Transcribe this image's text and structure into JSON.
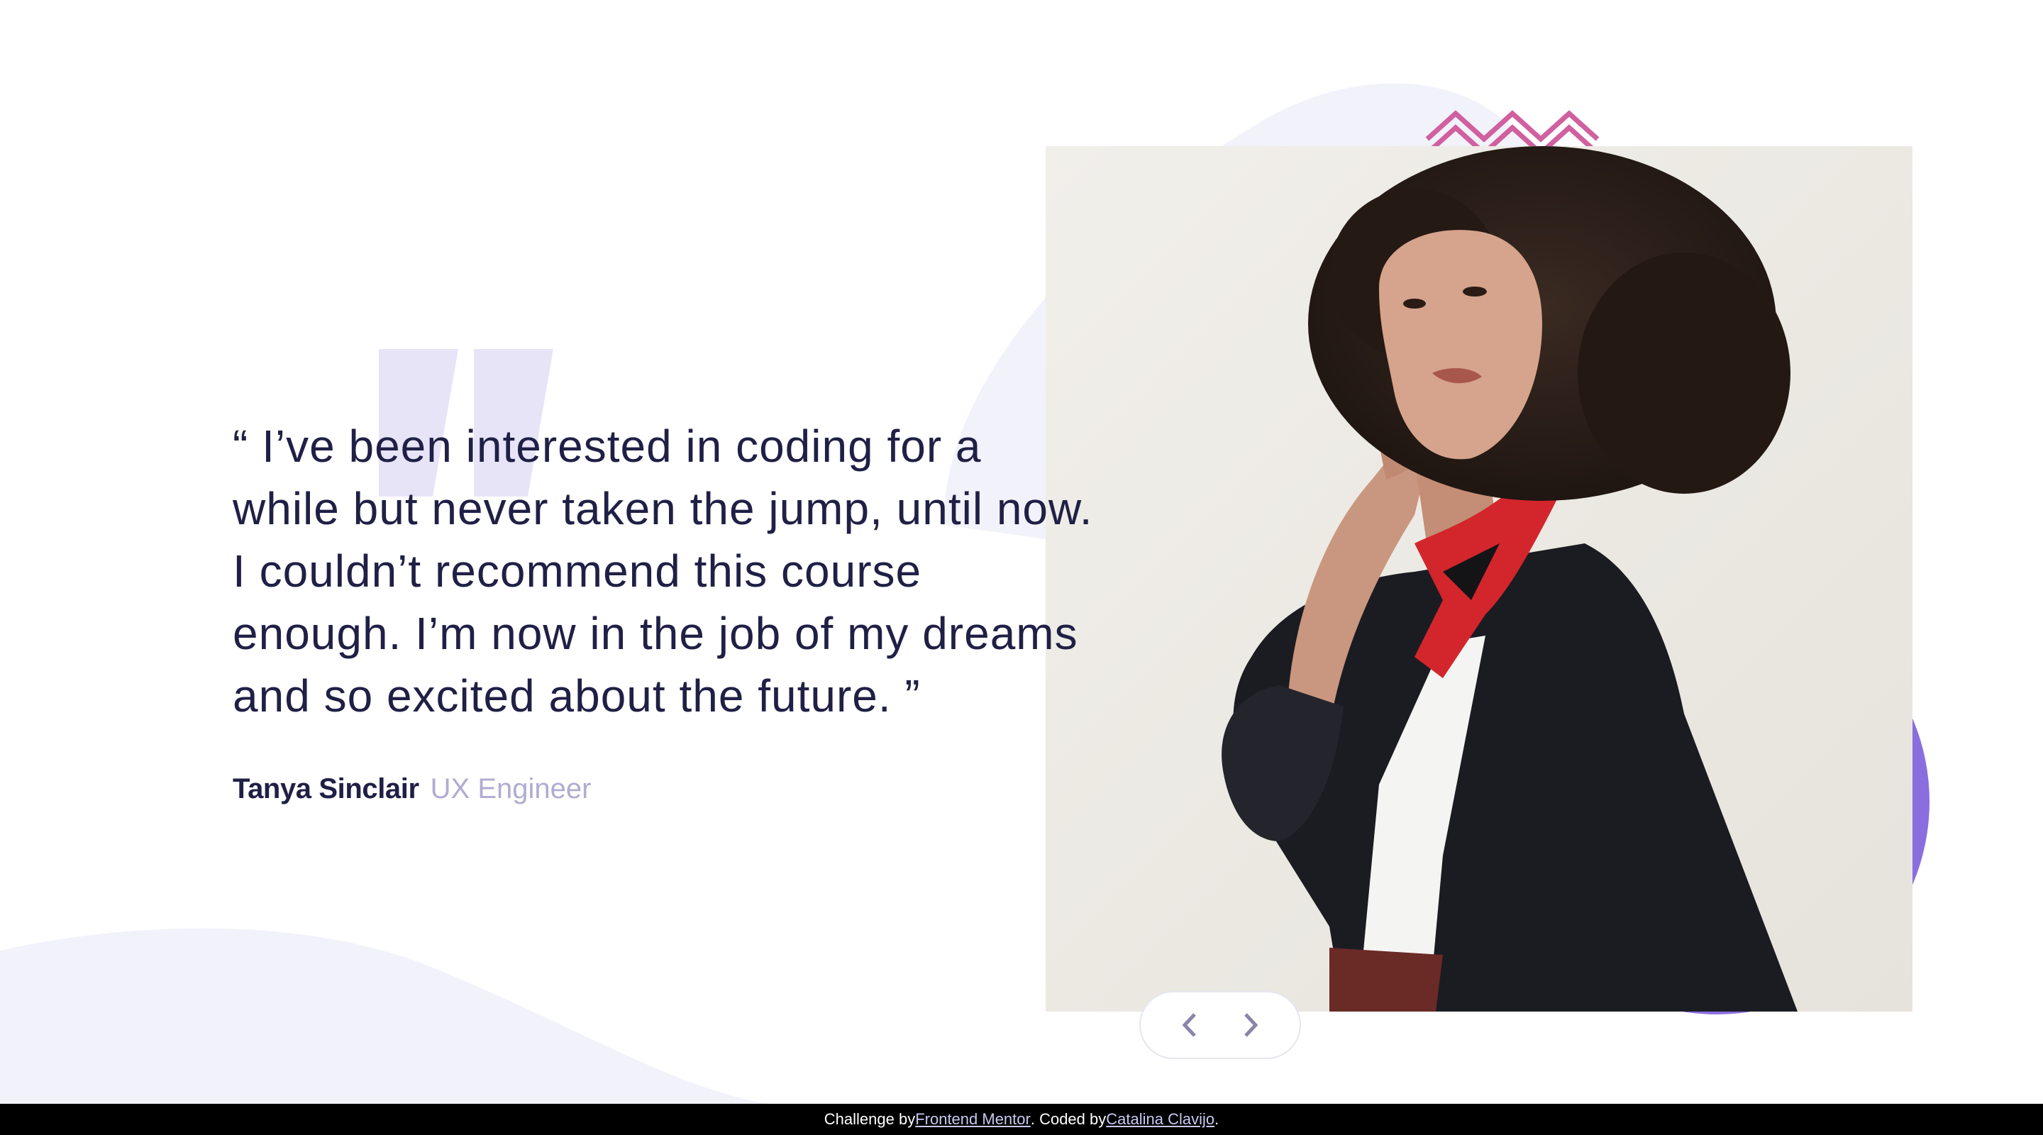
{
  "testimonial": {
    "quote": "“ I’ve been interested in coding for a\nwhile but never taken the jump, until now.\nI couldn’t recommend this course\nenough. I’m now in the job of my dreams\nand so excited about the future. ”",
    "author_name": "Tanya Sinclair",
    "author_role": "UX Engineer"
  },
  "photo": {
    "subject": "portrait-of-tanya"
  },
  "controls": {
    "prev_icon": "chevron-left-icon",
    "next_icon": "chevron-right-icon"
  },
  "footer": {
    "challenge_prefix": "Challenge by ",
    "challenge_link": "Frontend Mentor",
    "coded_prefix": ". Coded by ",
    "coded_link": "Catalina Clavijo",
    "suffix": "."
  },
  "colors": {
    "text_dark": "#202046",
    "text_muted": "#b0acd2",
    "blob_light": "#f2f2fb",
    "accent_purple": "#8a6ee0",
    "accent_pink": "#d0609f",
    "quote_mark": "#e7e4f8"
  }
}
